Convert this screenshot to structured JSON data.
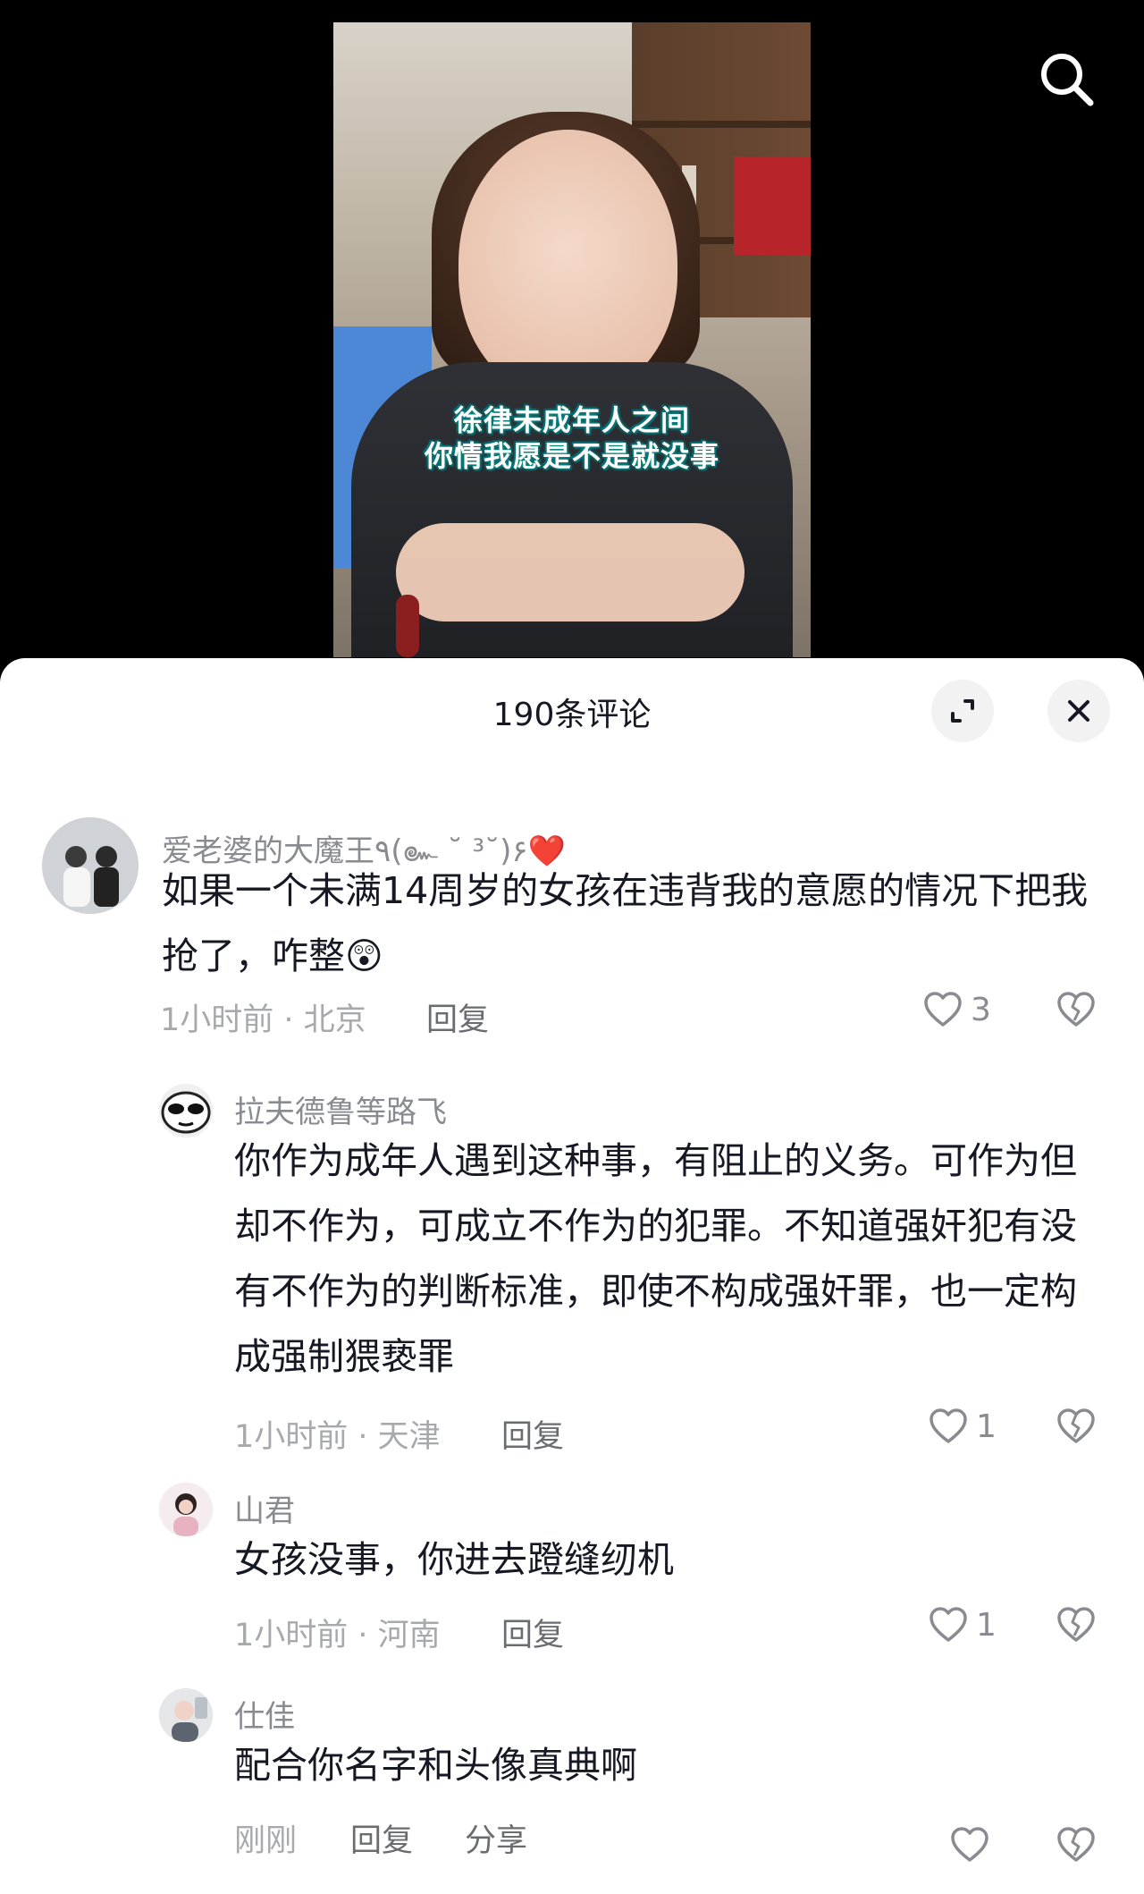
{
  "video": {
    "caption_line1": "徐律未成年人之间",
    "caption_line2": "你情我愿是不是就没事"
  },
  "sheet": {
    "title": "190条评论"
  },
  "comments": [
    {
      "username": "爱老婆的大魔王٩(๛ ˘ ³˘)۶❤️",
      "text": "如果一个未满14周岁的女孩在违背我的意愿的情况下把我抢了，咋整😲",
      "meta": "1小时前 · 北京",
      "reply_label": "回复",
      "likes": "3",
      "level": "top"
    },
    {
      "username": "拉夫德鲁等路飞",
      "text": "你作为成年人遇到这种事，有阻止的义务。可作为但却不作为，可成立不作为的犯罪。不知道强奸犯有没有不作为的判断标准，即使不构成强奸罪，也一定构成强制猥亵罪",
      "meta": "1小时前 · 天津",
      "reply_label": "回复",
      "likes": "1",
      "level": "reply"
    },
    {
      "username": "山君",
      "text": "女孩没事，你进去蹬缝纫机",
      "meta": "1小时前 · 河南",
      "reply_label": "回复",
      "likes": "1",
      "level": "reply"
    },
    {
      "username": "仕佳",
      "text": "配合你名字和头像真典啊",
      "meta": "刚刚",
      "reply_label": "回复",
      "share_label": "分享",
      "likes": "",
      "level": "reply"
    }
  ],
  "colors": {
    "text_primary": "#161823",
    "text_secondary": "#8a8b91",
    "meta": "#a8a9ad",
    "sheet_bg": "#ffffff",
    "icon_btn_bg": "#f2f2f3"
  },
  "icons": {
    "search": "search-icon",
    "expand": "expand-icon",
    "close": "close-icon",
    "like": "heart-icon",
    "dislike": "broken-heart-icon"
  }
}
